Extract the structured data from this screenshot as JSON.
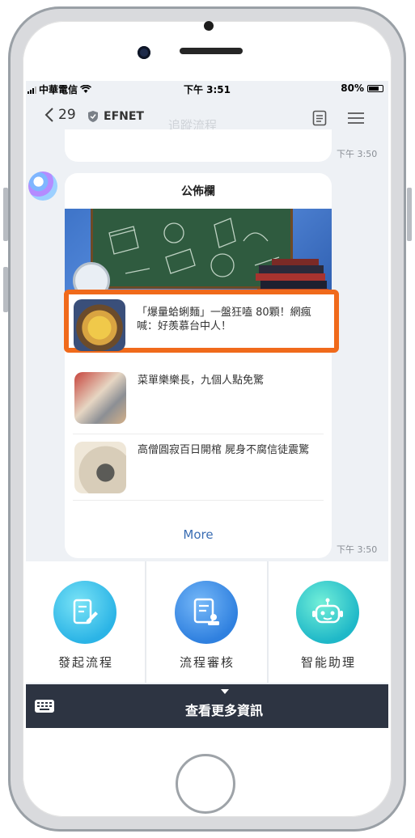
{
  "status_bar": {
    "carrier": "中華電信",
    "time": "下午 3:51",
    "battery": "80%"
  },
  "header": {
    "back_count": "29",
    "brand": "EFNET",
    "title": "追蹤流程"
  },
  "chat": {
    "timestamp_1": "下午 3:50",
    "timestamp_2": "下午 3:50",
    "card_title": "公佈欄",
    "news": [
      {
        "text": "「爆量蛤蜊麵」一盤狂嗑 80顆！網瘋喊：好羨慕台中人！"
      },
      {
        "text": "菜單樂樂長，九個人點免驚"
      },
      {
        "text": "高僧圓寂百日開棺 屍身不腐信徒震驚"
      }
    ],
    "more_label": "More"
  },
  "menu": {
    "items": [
      {
        "label": "發起流程",
        "icon": "edit-doc-icon"
      },
      {
        "label": "流程審核",
        "icon": "approve-stamp-icon"
      },
      {
        "label": "智能助理",
        "icon": "robot-icon"
      }
    ]
  },
  "bottom_bar": {
    "label": "查看更多資訊"
  },
  "colors": {
    "highlight": "#f06a1b",
    "accent_blue": "#3a6db3",
    "bottom_bar": "#2d3442"
  }
}
